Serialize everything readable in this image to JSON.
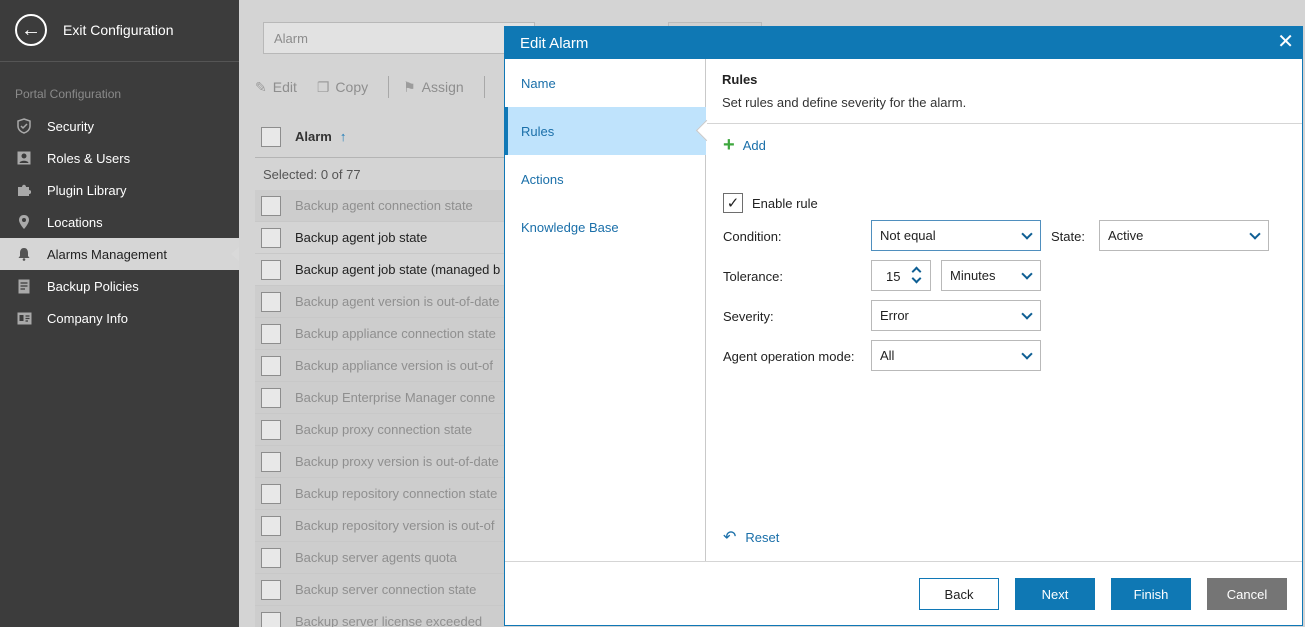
{
  "sidebar": {
    "exit_label": "Exit Configuration",
    "section_title": "Portal Configuration",
    "items": [
      {
        "label": "Security",
        "icon": "shield-icon"
      },
      {
        "label": "Roles & Users",
        "icon": "user-card-icon"
      },
      {
        "label": "Plugin Library",
        "icon": "puzzle-icon"
      },
      {
        "label": "Locations",
        "icon": "location-pin-icon"
      },
      {
        "label": "Alarms Management",
        "icon": "alarm-bell-icon",
        "active": true
      },
      {
        "label": "Backup Policies",
        "icon": "policy-document-icon"
      },
      {
        "label": "Company Info",
        "icon": "company-card-icon"
      }
    ]
  },
  "background": {
    "search_placeholder": "Alarm",
    "toolbar": {
      "edit": "Edit",
      "copy": "Copy",
      "assign": "Assign"
    },
    "column_header": "Alarm",
    "sort_indicator": "↑",
    "selected_text": "Selected: 0 of 77",
    "rows": [
      "Backup agent connection state",
      "Backup agent job state",
      "Backup agent job state (managed b",
      "Backup agent version is out-of-date",
      "Backup appliance connection state",
      "Backup appliance version is out-of",
      "Backup Enterprise Manager conne",
      "Backup proxy connection state",
      "Backup proxy version is out-of-date",
      "Backup repository connection state",
      "Backup repository version is out-of",
      "Backup server agents quota",
      "Backup server connection state",
      "Backup server license exceeded"
    ]
  },
  "dialog": {
    "title": "Edit Alarm",
    "steps": [
      "Name",
      "Rules",
      "Actions",
      "Knowledge Base"
    ],
    "active_step": "Rules",
    "content": {
      "title": "Rules",
      "subtitle": "Set rules and define severity for the alarm.",
      "add_label": "Add",
      "enable_rule_label": "Enable rule",
      "enable_rule_checked": true,
      "condition_label": "Condition:",
      "condition_value": "Not equal",
      "state_label": "State:",
      "state_value": "Active",
      "tolerance_label": "Tolerance:",
      "tolerance_value": "15",
      "tolerance_unit": "Minutes",
      "severity_label": "Severity:",
      "severity_value": "Error",
      "agent_mode_label": "Agent operation mode:",
      "agent_mode_value": "All",
      "reset_label": "Reset"
    },
    "buttons": {
      "back": "Back",
      "next": "Next",
      "finish": "Finish",
      "cancel": "Cancel"
    },
    "close_glyph": "✕"
  },
  "colors": {
    "accent": "#0f78b4",
    "sidebar_bg": "#3c3c3c",
    "active_step_bg": "#bfe3fc",
    "cancel_bg": "#757575",
    "add_green": "#3ea73e"
  }
}
